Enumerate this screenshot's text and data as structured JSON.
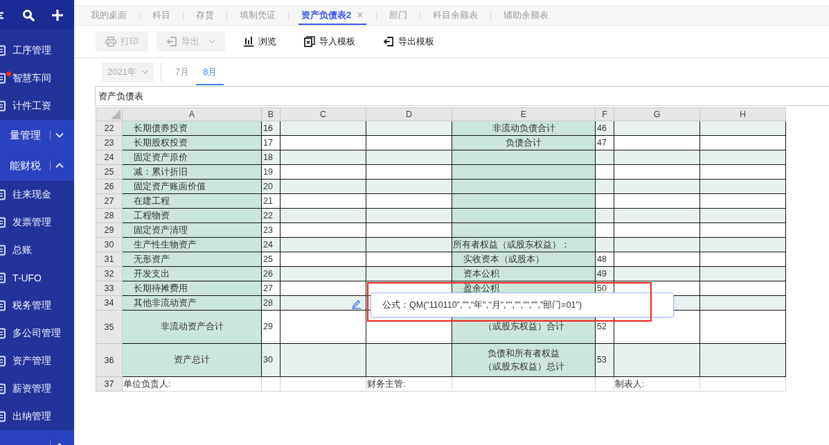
{
  "sidebar": {
    "entries": [
      {
        "kind": "item",
        "label": "工序管理",
        "badge": false
      },
      {
        "kind": "item",
        "label": "智慧车间",
        "badge": true
      },
      {
        "kind": "item",
        "label": "计件工资",
        "badge": false
      },
      {
        "kind": "group",
        "label": "量管理",
        "expanded": false
      },
      {
        "kind": "group",
        "label": "能财税",
        "expanded": true
      },
      {
        "kind": "item",
        "label": "往来现金",
        "badge": false
      },
      {
        "kind": "item",
        "label": "发票管理",
        "badge": false
      },
      {
        "kind": "item",
        "label": "总账",
        "badge": false
      },
      {
        "kind": "item",
        "label": "T-UFO",
        "badge": false
      },
      {
        "kind": "item",
        "label": "税务管理",
        "badge": false
      },
      {
        "kind": "item",
        "label": "多公司管理",
        "badge": false
      },
      {
        "kind": "item",
        "label": "资产管理",
        "badge": false
      },
      {
        "kind": "item",
        "label": "薪资管理",
        "badge": false
      },
      {
        "kind": "item",
        "label": "出纳管理",
        "badge": false
      },
      {
        "kind": "group",
        "expanded": true
      }
    ]
  },
  "tabs": [
    {
      "label": "我的桌面",
      "selected": false,
      "closable": false
    },
    {
      "label": "科目",
      "selected": false,
      "closable": false
    },
    {
      "label": "存货",
      "selected": false,
      "closable": false
    },
    {
      "label": "填制凭证",
      "selected": false,
      "closable": false
    },
    {
      "label": "资产负债表2",
      "selected": true,
      "closable": true,
      "close": "×"
    },
    {
      "label": "部门",
      "selected": false,
      "closable": false
    },
    {
      "label": "科目余额表",
      "selected": false,
      "closable": false
    },
    {
      "label": "辅助余额表",
      "selected": false,
      "closable": false
    }
  ],
  "toolbar": [
    {
      "kind": "print",
      "label": "打印",
      "disabled": true,
      "dropdown": false
    },
    {
      "kind": "export",
      "label": "导出",
      "disabled": true,
      "dropdown": true
    },
    {
      "kind": "browse",
      "label": "浏览",
      "disabled": false,
      "dropdown": false
    },
    {
      "kind": "import-template",
      "label": "导入模板",
      "disabled": false,
      "dropdown": false
    },
    {
      "kind": "export-template",
      "label": "导出模板",
      "disabled": false,
      "dropdown": false
    }
  ],
  "period": {
    "year": "2021年",
    "months": [
      {
        "label": "7月",
        "selected": false
      },
      {
        "label": "8月",
        "selected": true
      }
    ]
  },
  "sheet_title": "资产负债表",
  "sheet": {
    "columns": [
      {
        "label": "A",
        "kind": "label"
      },
      {
        "label": "B",
        "kind": "value"
      },
      {
        "label": "C",
        "kind": "value"
      },
      {
        "label": "D",
        "kind": "value"
      },
      {
        "label": "E",
        "kind": "label"
      },
      {
        "label": "F",
        "kind": "value"
      },
      {
        "label": "G",
        "kind": "value"
      },
      {
        "label": "H",
        "kind": "value"
      }
    ],
    "rows": [
      {
        "num": "22",
        "kind": "normal",
        "striped": true,
        "cells": {
          "A": {
            "kind": "item",
            "text": "长期债券投资"
          },
          "B": "16",
          "E": {
            "kind": "total",
            "text": "非流动负债合计"
          },
          "F": "46"
        }
      },
      {
        "num": "23",
        "kind": "normal",
        "striped": false,
        "cells": {
          "A": {
            "kind": "item",
            "text": "长期股权投资"
          },
          "B": "17",
          "E": {
            "kind": "total",
            "text": "负债合计"
          },
          "F": "47"
        }
      },
      {
        "num": "24",
        "kind": "normal",
        "striped": true,
        "cells": {
          "A": {
            "kind": "item",
            "text": "固定资产原价"
          },
          "B": "18"
        }
      },
      {
        "num": "25",
        "kind": "normal",
        "striped": false,
        "cells": {
          "A": {
            "kind": "item",
            "text": "减：累计折旧"
          },
          "B": "19"
        }
      },
      {
        "num": "26",
        "kind": "normal",
        "striped": true,
        "cells": {
          "A": {
            "kind": "item",
            "text": "固定资产账面价值"
          },
          "B": "20"
        }
      },
      {
        "num": "27",
        "kind": "normal",
        "striped": false,
        "cells": {
          "A": {
            "kind": "item",
            "text": "在建工程"
          },
          "B": "21"
        }
      },
      {
        "num": "28",
        "kind": "normal",
        "striped": true,
        "cells": {
          "A": {
            "kind": "item",
            "text": "工程物资"
          },
          "B": "22"
        }
      },
      {
        "num": "29",
        "kind": "normal",
        "striped": false,
        "cells": {
          "A": {
            "kind": "item",
            "text": "固定资产清理"
          },
          "B": "23"
        }
      },
      {
        "num": "30",
        "kind": "normal",
        "striped": true,
        "cells": {
          "A": {
            "kind": "item",
            "text": "生产性生物资产"
          },
          "B": "24",
          "E": {
            "kind": "section",
            "text": "所有者权益（或股东权益）："
          }
        }
      },
      {
        "num": "31",
        "kind": "normal",
        "striped": false,
        "cells": {
          "A": {
            "kind": "item",
            "text": "无形资产"
          },
          "B": "25",
          "E": {
            "kind": "item",
            "text": "实收资本（或股本）"
          },
          "F": "48"
        }
      },
      {
        "num": "32",
        "kind": "normal",
        "striped": true,
        "cells": {
          "A": {
            "kind": "item",
            "text": "开发支出"
          },
          "B": "26",
          "E": {
            "kind": "item",
            "text": "资本公积"
          },
          "F": "49"
        }
      },
      {
        "num": "33",
        "kind": "normal",
        "striped": false,
        "cells": {
          "A": {
            "kind": "item",
            "text": "长期待摊费用"
          },
          "B": "27",
          "E": {
            "kind": "item",
            "text": "盈余公积"
          },
          "F": "50"
        }
      },
      {
        "num": "34",
        "kind": "normal",
        "striped": true,
        "cells": {
          "A": {
            "kind": "item",
            "text": "其他非流动资产"
          },
          "B": "28"
        }
      },
      {
        "num": "35",
        "kind": "tall",
        "striped": false,
        "cells": {
          "A": {
            "kind": "total",
            "text": "非流动资产合计"
          },
          "B": "29",
          "E": {
            "kind": "total",
            "lines": [
              "（或股东权益）合计"
            ]
          },
          "F": "52"
        }
      },
      {
        "num": "36",
        "kind": "tall",
        "striped": true,
        "cells": {
          "A": {
            "kind": "total",
            "text": "资产总计"
          },
          "B": "30",
          "E": {
            "kind": "total",
            "lines": [
              "负债和所有者权益",
              "（或股东权益）总计"
            ]
          },
          "F": "53"
        }
      },
      {
        "num": "37",
        "kind": "footer",
        "cells": {
          "A": {
            "kind": "section",
            "text": "单位负责人:"
          },
          "D": {
            "kind": "section",
            "text": "财务主管:"
          },
          "G": {
            "kind": "section",
            "text": "制表人:"
          }
        }
      }
    ]
  },
  "formula_popup": {
    "text": "公式：QM(\"110110\",\"\",\"年\",\"月\",\"\",\"\",\"\",\"\",\"部门=01\")",
    "highlighted": true
  }
}
